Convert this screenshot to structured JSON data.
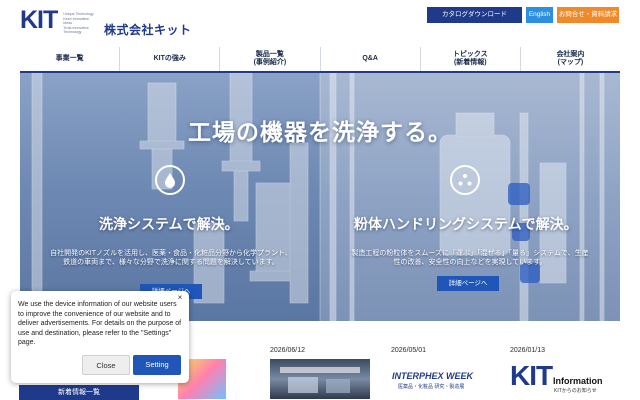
{
  "header": {
    "logo_text": "KIT",
    "logo_tagline": "Unique Technology\nKeen Innovative Ideas\nTrust-Innovative Technology",
    "company_name": "株式会社キット",
    "catalog_label": "カタログダウンロード",
    "english_label": "English",
    "inquiry_label": "お問合せ・資料請求"
  },
  "nav": {
    "items": [
      {
        "label": "事業一覧"
      },
      {
        "label": "KITの強み"
      },
      {
        "label": "製品一覧\n(事例紹介)"
      },
      {
        "label": "Q&A"
      },
      {
        "label": "トピックス\n(新着情報)"
      },
      {
        "label": "会社案内\n(マップ)"
      }
    ]
  },
  "hero": {
    "title": "工場の機器を洗浄する。",
    "left": {
      "title": "洗浄システムで解決。",
      "desc": "自社開発のKITノズルを活用し、医薬・食品・化粧品分野から化学プラント、鉄道の車両まで、様々な分野で洗浄に関する問題を解決しています。",
      "button": "詳細ページへ"
    },
    "right": {
      "title": "粉体ハンドリングシステムで解決。",
      "desc": "製造工程の粉粒体をスムーズに「運ぶ」「混ぜる」「量る」システムで、生産性の改善、安全性の向上などを実現しています。",
      "button": "詳細ページへ"
    }
  },
  "news": {
    "items": [
      {
        "date": "2026/06/12"
      },
      {
        "date": "2026/05/01",
        "thumb_text": "INTERPHEX WEEK",
        "thumb_sub": "医薬品・化粧品 研究・製造展"
      },
      {
        "date": "2026/01/13",
        "thumb_logo": "KIT",
        "thumb_text": "Information",
        "thumb_sub": "KITからのお知らせ"
      }
    ],
    "list_button": "新着情報一覧"
  },
  "cookie": {
    "text": "We use the device information of our website users to improve the convenience of our website and to deliver advertisements. For details on the purpose of use and destination, please refer to the \"Settings\" page.",
    "close_label": "Close",
    "setting_label": "Setting",
    "close_icon": "×"
  },
  "colors": {
    "brand": "#1f3a8a",
    "english": "#2d8fe0",
    "inquiry": "#f08a28",
    "button_blue": "#1f56b8"
  }
}
